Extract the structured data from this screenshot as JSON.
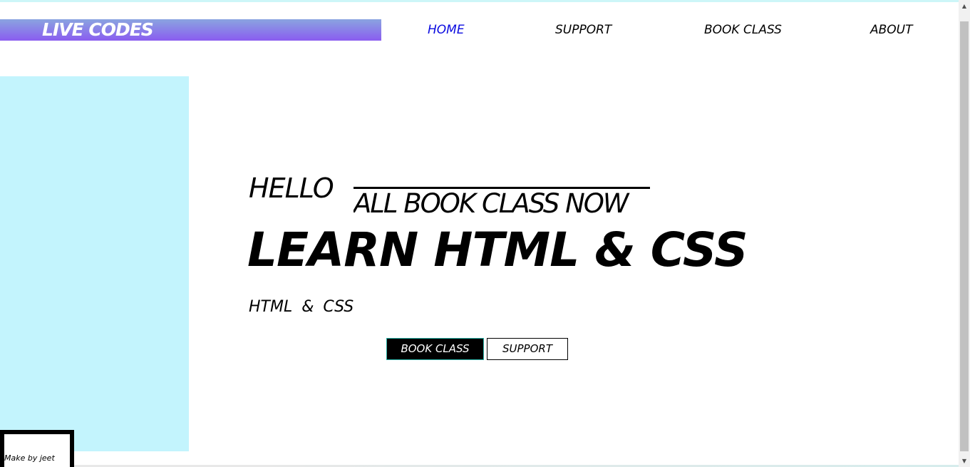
{
  "header": {
    "logo": "LIVE CODES",
    "nav": [
      {
        "label": "HOME",
        "active": true
      },
      {
        "label": "SUPPORT",
        "active": false
      },
      {
        "label": "BOOK CLASS",
        "active": false
      },
      {
        "label": "ABOUT",
        "active": false
      }
    ]
  },
  "hero": {
    "hello": "HELLO",
    "marquee": "ALL BOOK CLASS NOW",
    "headline": "LEARN HTML & CSS",
    "subtitle": "HTML & CSS",
    "buttons": {
      "book": "BOOK CLASS",
      "support": "SUPPORT"
    }
  },
  "footer": {
    "credit": "Make by jeet"
  },
  "scrollbar": {
    "up_icon": "▲",
    "down_icon": "▼"
  },
  "colors": {
    "active_nav": "#0b0be0",
    "side_panel": "#c3f4fd",
    "logo_gradient_top": "#8aa4e0",
    "logo_gradient_bottom": "#8a5cf0",
    "book_button_border": "#29b2a6"
  }
}
